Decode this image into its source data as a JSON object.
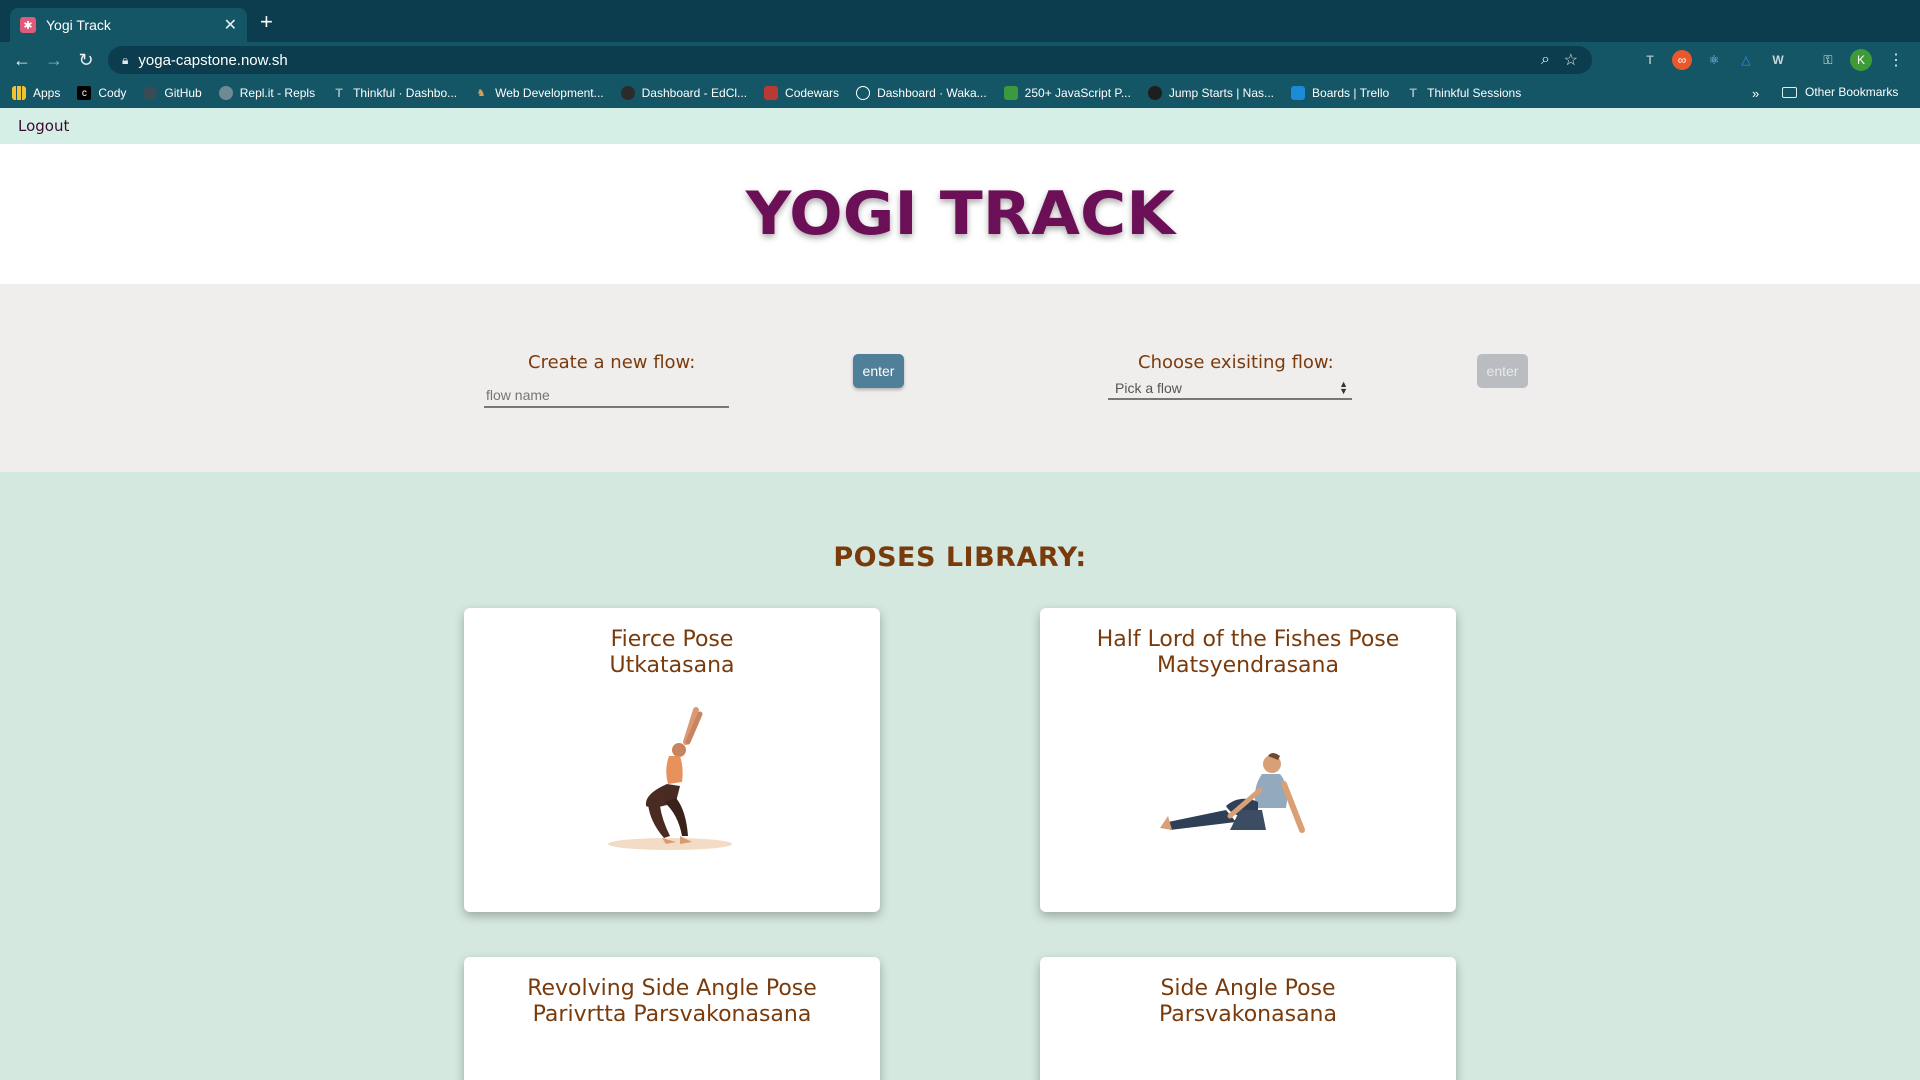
{
  "browser": {
    "tab_title": "Yogi Track",
    "url": "yoga-capstone.now.sh",
    "profile_initial": "K",
    "bookmarks": [
      "Apps",
      "Cody",
      "GitHub",
      "Repl.it - Repls",
      "Thinkful · Dashbo...",
      "Web Development...",
      "Dashboard - EdCl...",
      "Codewars",
      "Dashboard · Waka...",
      "250+ JavaScript P...",
      "Jump Starts | Nas...",
      "Boards | Trello",
      "Thinkful Sessions"
    ],
    "more": "»",
    "other_bookmarks": "Other Bookmarks"
  },
  "nav": {
    "logout": "Logout"
  },
  "header": {
    "brand": "YOGI TRACK"
  },
  "flows": {
    "create_label": "Create a new flow:",
    "create_placeholder": "flow name",
    "create_button": "enter",
    "choose_label": "Choose exisiting flow:",
    "choose_selected": "Pick a flow",
    "choose_button": "enter"
  },
  "library": {
    "title": "POSES LIBRARY:",
    "poses": [
      {
        "english": "Fierce Pose",
        "sanskrit": "Utkatasana"
      },
      {
        "english": "Half Lord of the Fishes Pose",
        "sanskrit": "Matsyendrasana"
      },
      {
        "english": "Revolving Side Angle Pose",
        "sanskrit": "Parivrtta Parsvakonasana"
      },
      {
        "english": "Side Angle Pose",
        "sanskrit": "Parsvakonasana"
      }
    ]
  },
  "colors": {
    "brand": "#6b0f57",
    "accent_text": "#7a3b0c",
    "primary_button": "#4f7f99",
    "library_bg": "#d5e8e0"
  }
}
